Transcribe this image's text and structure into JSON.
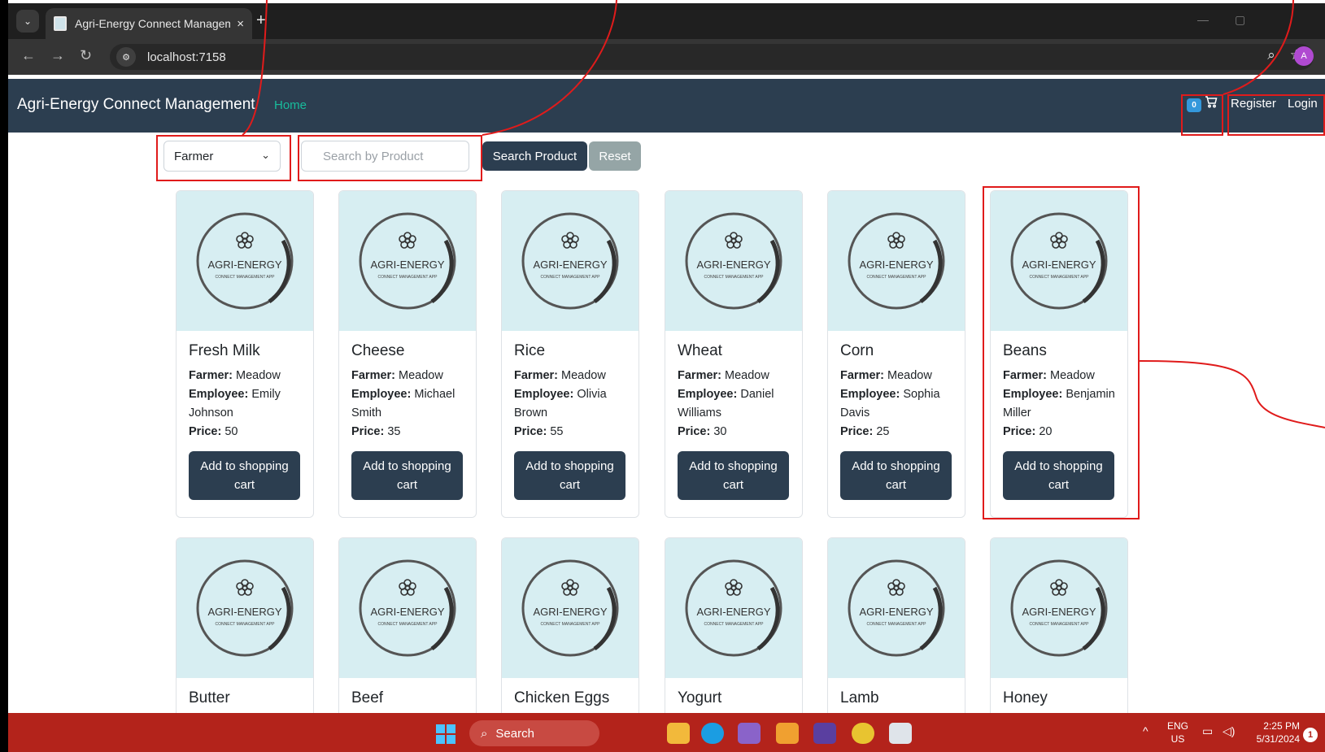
{
  "browser": {
    "tab_title": "Agri-Energy Connect Managem",
    "tab_close": "×",
    "new_tab": "+",
    "url": "localhost:7158",
    "profile_initial": "A"
  },
  "navbar": {
    "brand": "Agri-Energy Connect Management",
    "home": "Home",
    "cart_count": "0",
    "register": "Register",
    "login": "Login"
  },
  "filters": {
    "select_value": "Farmer",
    "search_placeholder": "Search by Product",
    "search_button": "Search Product",
    "reset_button": "Reset"
  },
  "logo": {
    "title": "AGRI-ENERGY",
    "subtitle": "CONNECT MANAGEMENT APP"
  },
  "labels": {
    "farmer": "Farmer:",
    "employee": "Employee:",
    "price": "Price:",
    "add_to_cart": "Add to shopping cart"
  },
  "products": [
    {
      "name": "Fresh Milk",
      "farmer": "Meadow",
      "employee": "Emily Johnson",
      "price": "50"
    },
    {
      "name": "Cheese",
      "farmer": "Meadow",
      "employee": "Michael Smith",
      "price": "35"
    },
    {
      "name": "Rice",
      "farmer": "Meadow",
      "employee": "Olivia Brown",
      "price": "55"
    },
    {
      "name": "Wheat",
      "farmer": "Meadow",
      "employee": "Daniel Williams",
      "price": "30"
    },
    {
      "name": "Corn",
      "farmer": "Meadow",
      "employee": "Sophia Davis",
      "price": "25"
    },
    {
      "name": "Beans",
      "farmer": "Meadow",
      "employee": "Benjamin Miller",
      "price": "20"
    },
    {
      "name": "Butter"
    },
    {
      "name": "Beef"
    },
    {
      "name": "Chicken Eggs"
    },
    {
      "name": "Yogurt"
    },
    {
      "name": "Lamb"
    },
    {
      "name": "Honey"
    }
  ],
  "taskbar": {
    "search": "Search",
    "lang_top": "ENG",
    "lang_bottom": "US",
    "time": "2:25 PM",
    "date": "5/31/2024",
    "notifications": "1"
  },
  "colors": {
    "navbar": "#2c3e50",
    "accent_link": "#18bc9c",
    "card_image_bg": "#d7eef2",
    "annotation": "#e01b1b",
    "taskbar": "#b3231b"
  }
}
